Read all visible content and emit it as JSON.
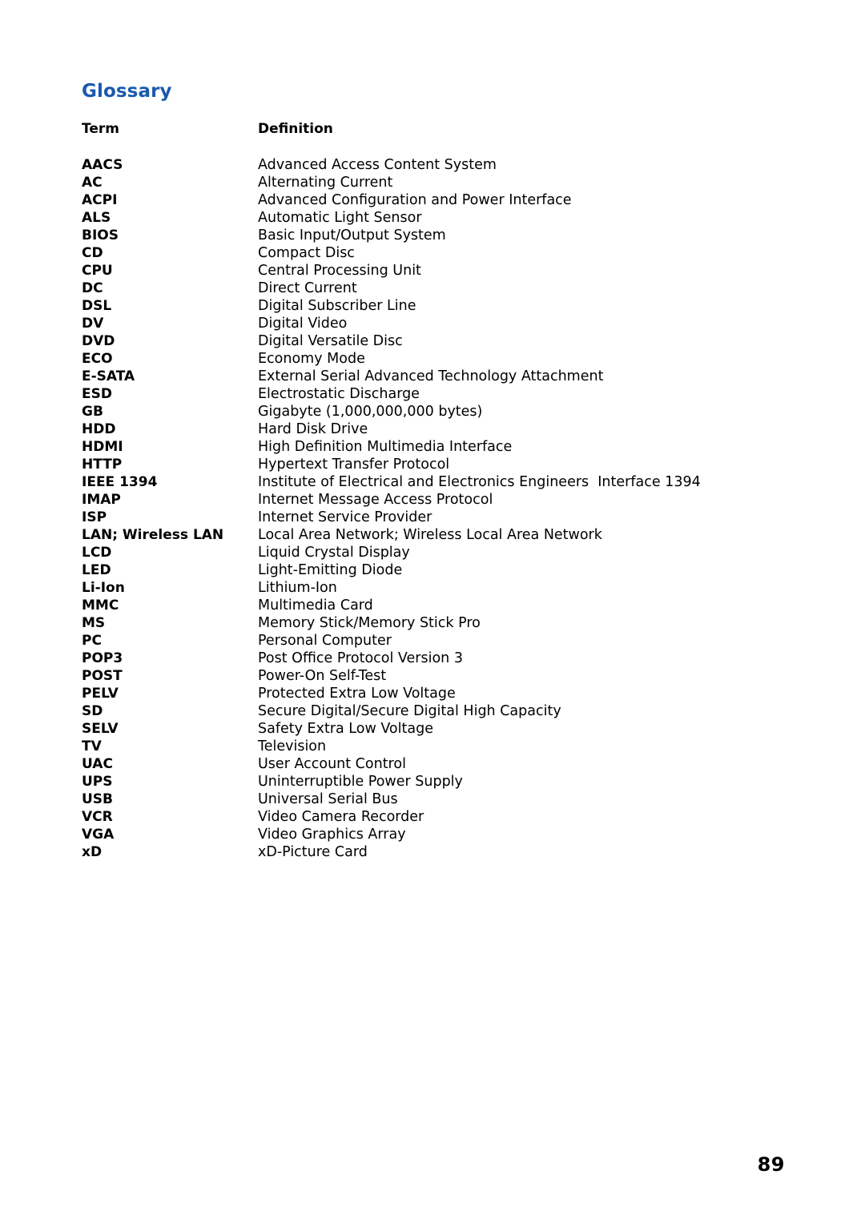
{
  "document": {
    "title": "Glossary",
    "title_color": "#1a5aad",
    "page_number": "89"
  },
  "table": {
    "headers": {
      "term": "Term",
      "definition": "Definition"
    },
    "rows": [
      {
        "term": "AACS",
        "definition": "Advanced Access Content System"
      },
      {
        "term": "AC",
        "definition": "Alternating Current"
      },
      {
        "term": "ACPI",
        "definition": "Advanced Configuration and Power Interface"
      },
      {
        "term": "ALS",
        "definition": "Automatic Light Sensor"
      },
      {
        "term": "BIOS",
        "definition": "Basic Input/Output System"
      },
      {
        "term": "CD",
        "definition": "Compact Disc"
      },
      {
        "term": "CPU",
        "definition": "Central Processing Unit"
      },
      {
        "term": "DC",
        "definition": "Direct Current"
      },
      {
        "term": "DSL",
        "definition": "Digital Subscriber Line"
      },
      {
        "term": "DV",
        "definition": "Digital Video"
      },
      {
        "term": "DVD",
        "definition": "Digital Versatile Disc"
      },
      {
        "term": "ECO",
        "definition": "Economy Mode"
      },
      {
        "term": "E-SATA",
        "definition": "External Serial Advanced Technology Attachment"
      },
      {
        "term": "ESD",
        "definition": "Electrostatic Discharge"
      },
      {
        "term": "GB",
        "definition": "Gigabyte (1,000,000,000 bytes)"
      },
      {
        "term": "HDD",
        "definition": "Hard Disk Drive"
      },
      {
        "term": "HDMI",
        "definition": "High Definition Multimedia Interface"
      },
      {
        "term": "HTTP",
        "definition": "Hypertext Transfer Protocol"
      },
      {
        "term": "IEEE 1394",
        "definition": "Institute of Electrical and Electronics Engineers  Interface 1394"
      },
      {
        "term": "IMAP",
        "definition": "Internet Message Access Protocol"
      },
      {
        "term": "ISP",
        "definition": "Internet Service Provider"
      },
      {
        "term": "LAN; Wireless LAN",
        "definition": "Local Area Network; Wireless Local Area Network"
      },
      {
        "term": "LCD",
        "definition": "Liquid Crystal Display"
      },
      {
        "term": "LED",
        "definition": "Light-Emitting Diode"
      },
      {
        "term": "Li-Ion",
        "definition": "Lithium-Ion"
      },
      {
        "term": "MMC",
        "definition": "Multimedia Card"
      },
      {
        "term": "MS",
        "definition": "Memory Stick/Memory Stick Pro"
      },
      {
        "term": "PC",
        "definition": "Personal Computer"
      },
      {
        "term": "POP3",
        "definition": "Post Office Protocol Version 3"
      },
      {
        "term": "POST",
        "definition": "Power-On Self-Test"
      },
      {
        "term": "PELV",
        "definition": "Protected Extra Low Voltage"
      },
      {
        "term": "SD",
        "definition": "Secure Digital/Secure Digital High Capacity"
      },
      {
        "term": "SELV",
        "definition": "Safety Extra Low Voltage"
      },
      {
        "term": "TV",
        "definition": "Television"
      },
      {
        "term": "UAC",
        "definition": "User Account Control"
      },
      {
        "term": "UPS",
        "definition": "Uninterruptible Power Supply"
      },
      {
        "term": "USB",
        "definition": "Universal Serial Bus"
      },
      {
        "term": "VCR",
        "definition": "Video Camera Recorder"
      },
      {
        "term": "VGA",
        "definition": "Video Graphics Array"
      },
      {
        "term": "xD",
        "definition": "xD-Picture Card"
      }
    ]
  }
}
